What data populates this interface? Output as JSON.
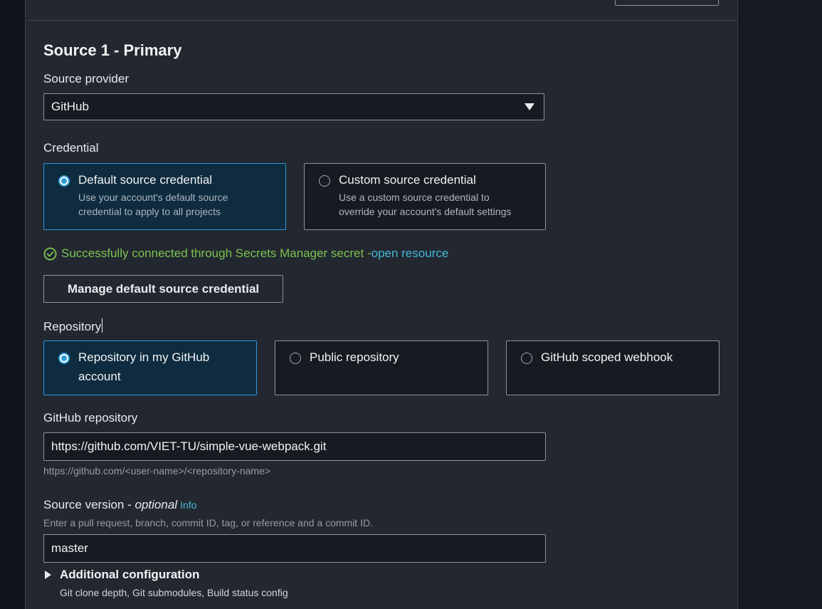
{
  "section": {
    "title": "Source 1 - Primary"
  },
  "source_provider": {
    "label": "Source provider",
    "selected_value": "GitHub"
  },
  "credential": {
    "label": "Credential",
    "options": [
      {
        "title": "Default source credential",
        "description_line1": "Use your account's default source",
        "description_line2": "credential to apply to all projects",
        "selected": true
      },
      {
        "title": "Custom source credential",
        "description_line1": "Use a custom source credential to",
        "description_line2": "override your account's default settings",
        "selected": false
      }
    ],
    "status_text": "Successfully connected through Secrets Manager secret - ",
    "status_link": "open resource",
    "manage_button_label": "Manage default source credential"
  },
  "repository": {
    "label": "Repository",
    "options": [
      {
        "title_line1": "Repository in my GitHub",
        "title_line2": "account",
        "selected": true
      },
      {
        "title_line1": "Public repository",
        "selected": false
      },
      {
        "title_line1": "GitHub scoped webhook",
        "selected": false
      }
    ]
  },
  "github_repository": {
    "label": "GitHub repository",
    "value": "https://github.com/VIET-TU/simple-vue-webpack.git",
    "hint": "https://github.com/<user-name>/<repository-name>"
  },
  "source_version": {
    "label": "Source version - ",
    "label_optional": "optional",
    "info_link": "Info",
    "description": "Enter a pull request, branch, commit ID, tag, or reference and a commit ID.",
    "value": "master"
  },
  "additional_configuration": {
    "title": "Additional configuration",
    "description": "Git clone depth, Git submodules, Build status config"
  },
  "colors": {
    "success": "#7bc34f",
    "link": "#44b9d6",
    "selected_border": "#2d9ad8",
    "selected_bg": "#0e2b3f",
    "panel_bg": "#232730"
  },
  "icons": {
    "select_caret": "caret-down-icon",
    "status": "check-circle-icon",
    "expand": "caret-right-icon"
  }
}
